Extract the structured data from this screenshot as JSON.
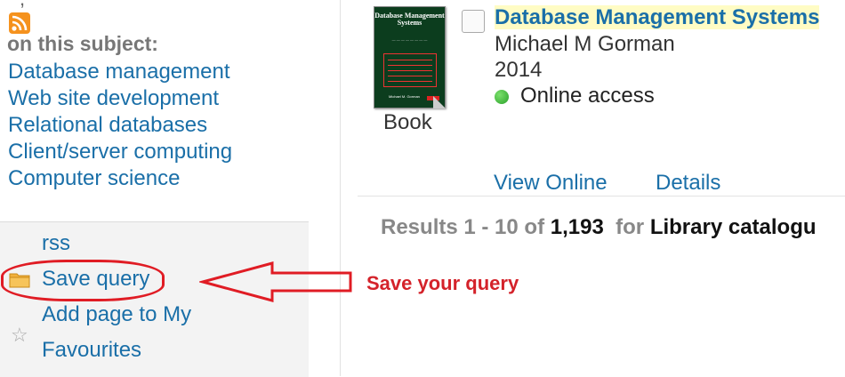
{
  "top_crumb": ",",
  "subjects": {
    "heading": "on this subject:",
    "items": [
      "Database management",
      "Web site development",
      "Relational databases",
      "Client/server computing",
      "Computer science"
    ]
  },
  "tools": {
    "rss_label": "rss",
    "save_query_label": "Save query",
    "favourites_line1": "Add page to My",
    "favourites_line2": "Favourites",
    "icons": [
      "rss-icon",
      "folder-icon",
      "star-icon"
    ]
  },
  "result": {
    "cover": {
      "title": "Database Management Systems",
      "author": "Michael M. Gorman"
    },
    "format": "Book",
    "title_highlighted": "Database Management Systems",
    "author": "Michael M Gorman",
    "year": "2014",
    "availability": "Online access",
    "availability_color": "#2aa12a",
    "links": {
      "view_online": "View Online",
      "details": "Details"
    }
  },
  "summary": {
    "prefix": "Results 1 - 10 of",
    "count": "1,193",
    "for": "for",
    "scope": "Library catalogu"
  },
  "annotation": {
    "text": "Save your query",
    "color": "#e01c24"
  }
}
